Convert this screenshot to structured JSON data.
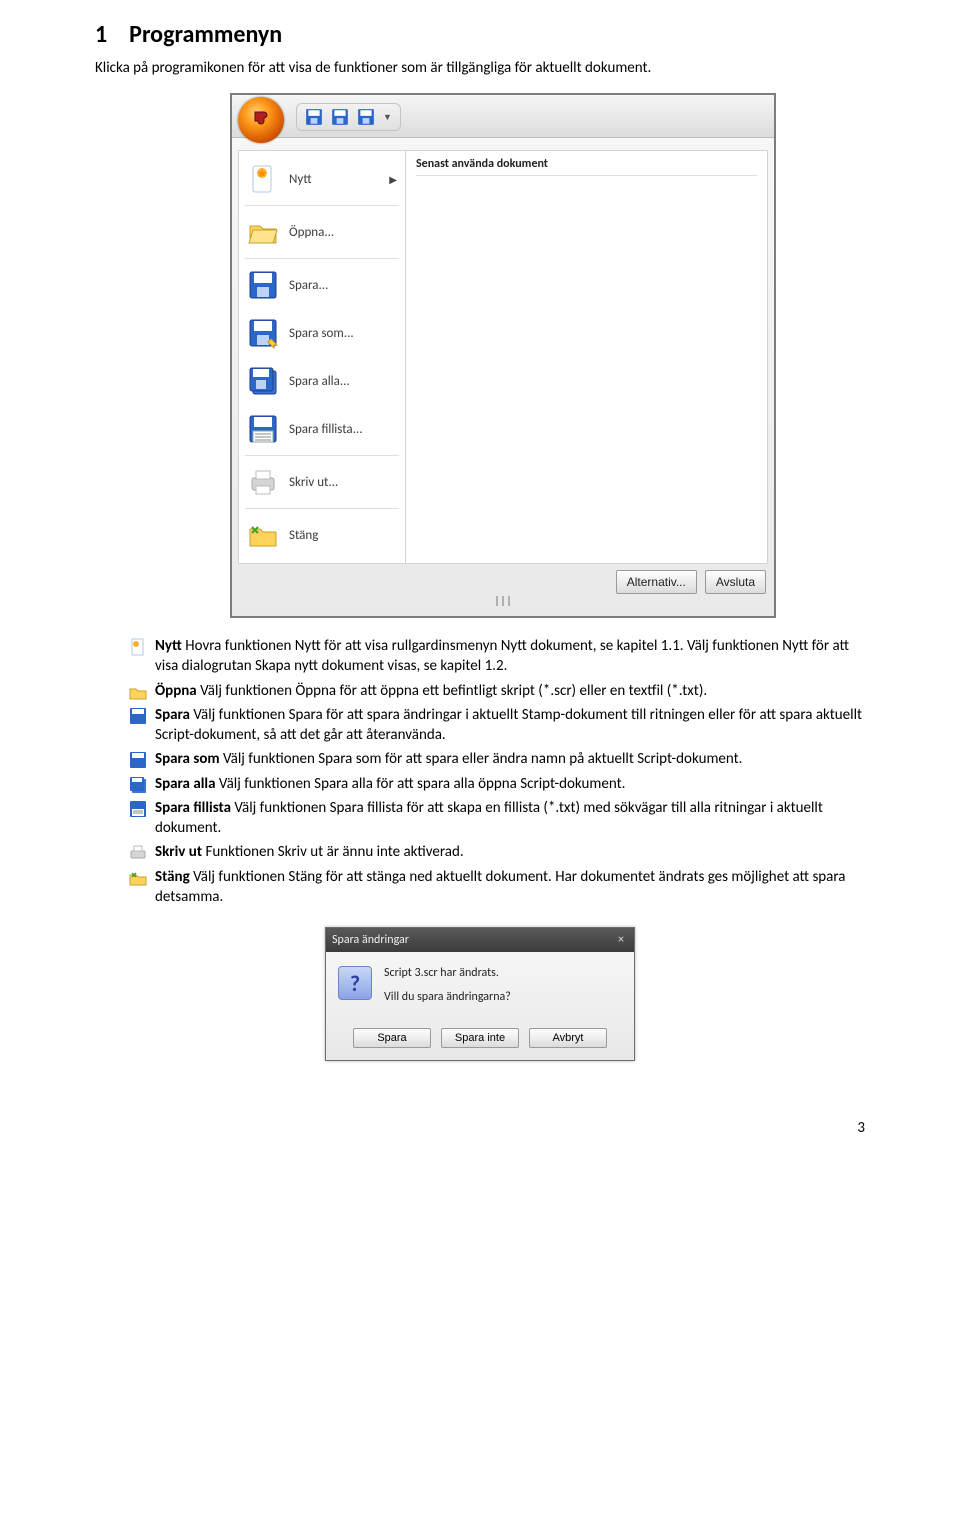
{
  "heading_number": "1",
  "heading_title": "Programmenyn",
  "intro_text": "Klicka på programikonen för att visa de funktioner som är tillgängliga för aktuellt dokument.",
  "menu": {
    "recent_header": "Senast använda dokument",
    "items": [
      {
        "label": "Nytt",
        "has_arrow": true
      },
      {
        "label": "Öppna...",
        "has_arrow": false
      },
      {
        "label": "Spara...",
        "has_arrow": false
      },
      {
        "label": "Spara som...",
        "has_arrow": false
      },
      {
        "label": "Spara alla...",
        "has_arrow": false
      },
      {
        "label": "Spara fillista...",
        "has_arrow": false
      },
      {
        "label": "Skriv ut...",
        "has_arrow": false
      },
      {
        "label": "Stäng",
        "has_arrow": false
      }
    ],
    "footer": {
      "options": "Alternativ...",
      "exit": "Avsluta"
    }
  },
  "descriptions": [
    {
      "term": "Nytt",
      "text": " Hovra funktionen Nytt för att visa rullgardinsmenyn Nytt dokument, se kapitel 1.1. Välj funktionen Nytt för att visa dialogrutan Skapa nytt dokument visas, se kapitel 1.2."
    },
    {
      "term": "Öppna",
      "text": " Välj funktionen Öppna för att öppna ett befintligt skript (*.scr) eller en textfil (*.txt)."
    },
    {
      "term": "Spara",
      "text": " Välj funktionen Spara för att spara ändringar i aktuellt Stamp-dokument till ritningen eller för att spara aktuellt Script-dokument, så att det går att återanvända."
    },
    {
      "term": "Spara som",
      "text": " Välj funktionen Spara som för att spara eller ändra namn på aktuellt Script-dokument."
    },
    {
      "term": "Spara alla",
      "text": " Välj funktionen Spara alla för att spara alla öppna Script-dokument."
    },
    {
      "term": "Spara fillista",
      "text": " Välj funktionen Spara fillista för att skapa en fillista (*.txt) med sökvägar till alla ritningar i aktuellt dokument."
    },
    {
      "term": "Skriv ut",
      "text": " Funktionen Skriv ut är ännu inte aktiverad."
    },
    {
      "term": "Stäng",
      "text": " Välj funktionen Stäng för att stänga ned aktuellt dokument. Har dokumentet ändrats ges möjlighet att spara detsamma."
    }
  ],
  "dialog": {
    "title": "Spara ändringar",
    "line1": "Script 3.scr har ändrats.",
    "line2": "Vill du spara ändringarna?",
    "buttons": {
      "save": "Spara",
      "dont_save": "Spara inte",
      "cancel": "Avbryt"
    }
  },
  "page_number": "3"
}
